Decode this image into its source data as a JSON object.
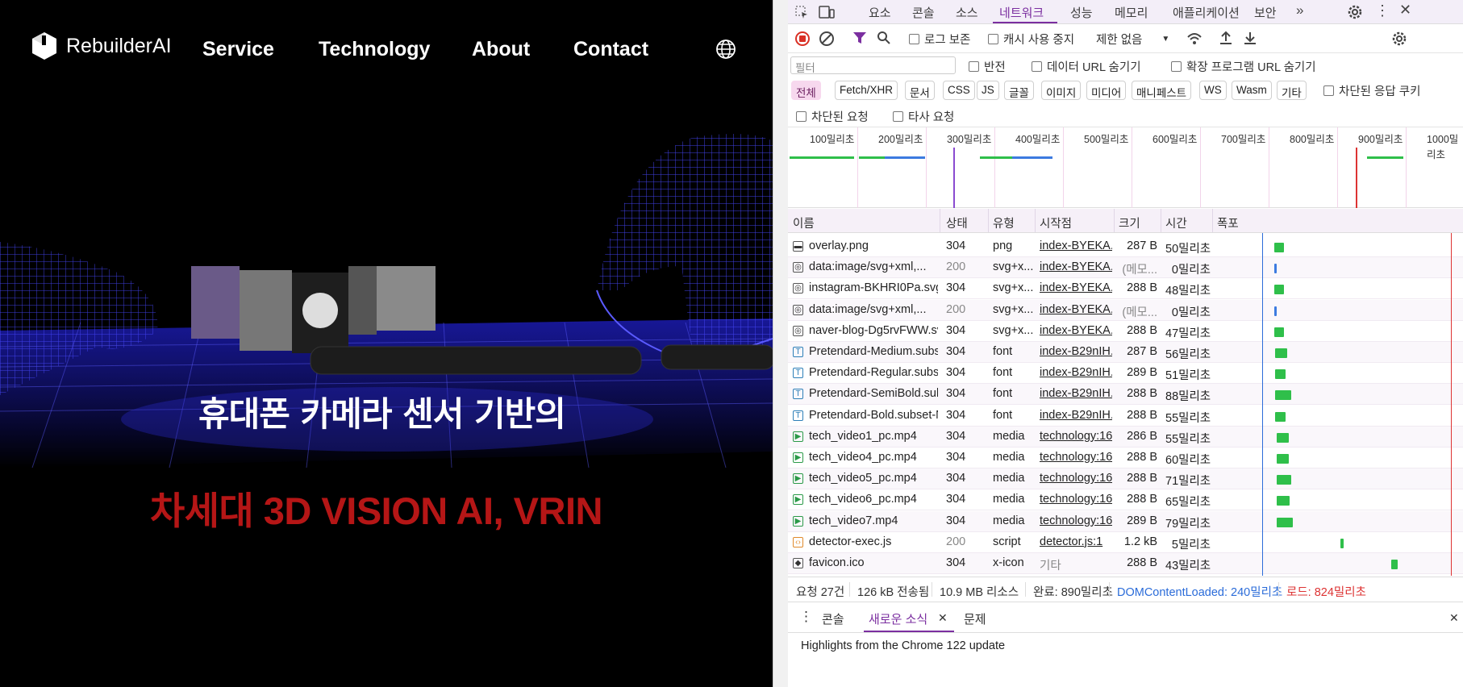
{
  "site": {
    "logo_text": "RebuilderAI",
    "nav": [
      "Service",
      "Technology",
      "About",
      "Contact"
    ],
    "hero_line1": "휴대폰 카메라 센서 기반의",
    "hero_line2": "차세대 3D VISION AI, VRIN",
    "colors": {
      "background": "#000000",
      "accent": "#b51616",
      "mesh": "#3a3aff"
    }
  },
  "devtools": {
    "tabs": [
      "요소",
      "콘솔",
      "소스",
      "네트워크",
      "성능",
      "메모리",
      "애플리케이션",
      "보안"
    ],
    "active_tab": "네트워크",
    "toolbar": {
      "preserve_log": "로그 보존",
      "disable_cache": "캐시 사용 중지",
      "throttle": "제한 없음"
    },
    "filter_placeholder": "필터",
    "filter_options": [
      "반전",
      "데이터 URL 숨기기",
      "확장 프로그램 URL 숨기기"
    ],
    "type_filters": [
      "전체",
      "Fetch/XHR",
      "문서",
      "CSS",
      "JS",
      "글꼴",
      "이미지",
      "미디어",
      "매니페스트",
      "WS",
      "Wasm",
      "기타"
    ],
    "blocked_cookies": "차단된 응답 쿠키",
    "blocked_requests": "차단된 요청",
    "third_party": "타사 요청",
    "timeline_ticks": [
      "100밀리초",
      "200밀리초",
      "300밀리초",
      "400밀리초",
      "500밀리초",
      "600밀리초",
      "700밀리초",
      "800밀리초",
      "900밀리초",
      "1000밀리초"
    ],
    "columns": [
      "이름",
      "상태",
      "유형",
      "시작점",
      "크기",
      "시간",
      "폭포"
    ],
    "rows": [
      {
        "name": "overlay.png",
        "status": "304",
        "type": "png",
        "initiator": "index-BYEKA...",
        "size": "287 B",
        "time": "50밀리초",
        "icon": "image",
        "wf_start": 0.17,
        "wf_len": 0.07
      },
      {
        "name": "data:image/svg+xml,...",
        "status": "200",
        "type": "svg+x...",
        "initiator": "index-BYEKA...",
        "size": "(메모...",
        "time": "0밀리초",
        "icon": "svg",
        "wf_start": 0.17,
        "wf_len": 0.01
      },
      {
        "name": "instagram-BKHRI0Pa.svg",
        "status": "304",
        "type": "svg+x...",
        "initiator": "index-BYEKA...",
        "size": "288 B",
        "time": "48밀리초",
        "icon": "svg",
        "wf_start": 0.17,
        "wf_len": 0.07
      },
      {
        "name": "data:image/svg+xml,...",
        "status": "200",
        "type": "svg+x...",
        "initiator": "index-BYEKA...",
        "size": "(메모...",
        "time": "0밀리초",
        "icon": "svg",
        "wf_start": 0.17,
        "wf_len": 0.01
      },
      {
        "name": "naver-blog-Dg5rvFWW.svg",
        "status": "304",
        "type": "svg+x...",
        "initiator": "index-BYEKA...",
        "size": "288 B",
        "time": "47밀리초",
        "icon": "svg",
        "wf_start": 0.17,
        "wf_len": 0.07
      },
      {
        "name": "Pretendard-Medium.subs...",
        "status": "304",
        "type": "font",
        "initiator": "index-B29nIH...",
        "size": "287 B",
        "time": "56밀리초",
        "icon": "font",
        "wf_start": 0.18,
        "wf_len": 0.08
      },
      {
        "name": "Pretendard-Regular.subse...",
        "status": "304",
        "type": "font",
        "initiator": "index-B29nIH...",
        "size": "289 B",
        "time": "51밀리초",
        "icon": "font",
        "wf_start": 0.18,
        "wf_len": 0.07
      },
      {
        "name": "Pretendard-SemiBold.sub...",
        "status": "304",
        "type": "font",
        "initiator": "index-B29nIH...",
        "size": "288 B",
        "time": "88밀리초",
        "icon": "font",
        "wf_start": 0.18,
        "wf_len": 0.11
      },
      {
        "name": "Pretendard-Bold.subset-N...",
        "status": "304",
        "type": "font",
        "initiator": "index-B29nIH...",
        "size": "288 B",
        "time": "55밀리초",
        "icon": "font",
        "wf_start": 0.18,
        "wf_len": 0.07
      },
      {
        "name": "tech_video1_pc.mp4",
        "status": "304",
        "type": "media",
        "initiator": "technology:16",
        "size": "286 B",
        "time": "55밀리초",
        "icon": "media",
        "wf_start": 0.19,
        "wf_len": 0.08
      },
      {
        "name": "tech_video4_pc.mp4",
        "status": "304",
        "type": "media",
        "initiator": "technology:16",
        "size": "288 B",
        "time": "60밀리초",
        "icon": "media",
        "wf_start": 0.19,
        "wf_len": 0.08
      },
      {
        "name": "tech_video5_pc.mp4",
        "status": "304",
        "type": "media",
        "initiator": "technology:16",
        "size": "288 B",
        "time": "71밀리초",
        "icon": "media",
        "wf_start": 0.19,
        "wf_len": 0.1
      },
      {
        "name": "tech_video6_pc.mp4",
        "status": "304",
        "type": "media",
        "initiator": "technology:16",
        "size": "288 B",
        "time": "65밀리초",
        "icon": "media",
        "wf_start": 0.19,
        "wf_len": 0.09
      },
      {
        "name": "tech_video7.mp4",
        "status": "304",
        "type": "media",
        "initiator": "technology:16",
        "size": "289 B",
        "time": "79밀리초",
        "icon": "media",
        "wf_start": 0.19,
        "wf_len": 0.11
      },
      {
        "name": "detector-exec.js",
        "status": "200",
        "type": "script",
        "initiator": "detector.js:1",
        "size": "1.2 kB",
        "time": "5밀리초",
        "icon": "script",
        "wf_start": 0.63,
        "wf_len": 0.02
      },
      {
        "name": "favicon.ico",
        "status": "304",
        "type": "x-icon",
        "initiator": "기타",
        "size": "288 B",
        "time": "43밀리초",
        "icon": "icon",
        "wf_start": 0.98,
        "wf_len": 0.04
      }
    ],
    "summary": {
      "requests": "요청 27건",
      "transferred": "126 kB 전송됨",
      "resources": "10.9 MB 리소스",
      "finish": "완료: 890밀리초",
      "dcl": "DOMContentLoaded: 240밀리초",
      "load": "로드: 824밀리초"
    },
    "drawer_tabs": [
      "콘솔",
      "새로운 소식",
      "문제"
    ],
    "drawer_active": "새로운 소식",
    "drawer_text": "Highlights from the Chrome 122 update",
    "colors": {
      "accent": "#7b2fa0",
      "dcl": "#2b6cd9",
      "load": "#d33",
      "bar_green": "#2fbf4a"
    }
  }
}
